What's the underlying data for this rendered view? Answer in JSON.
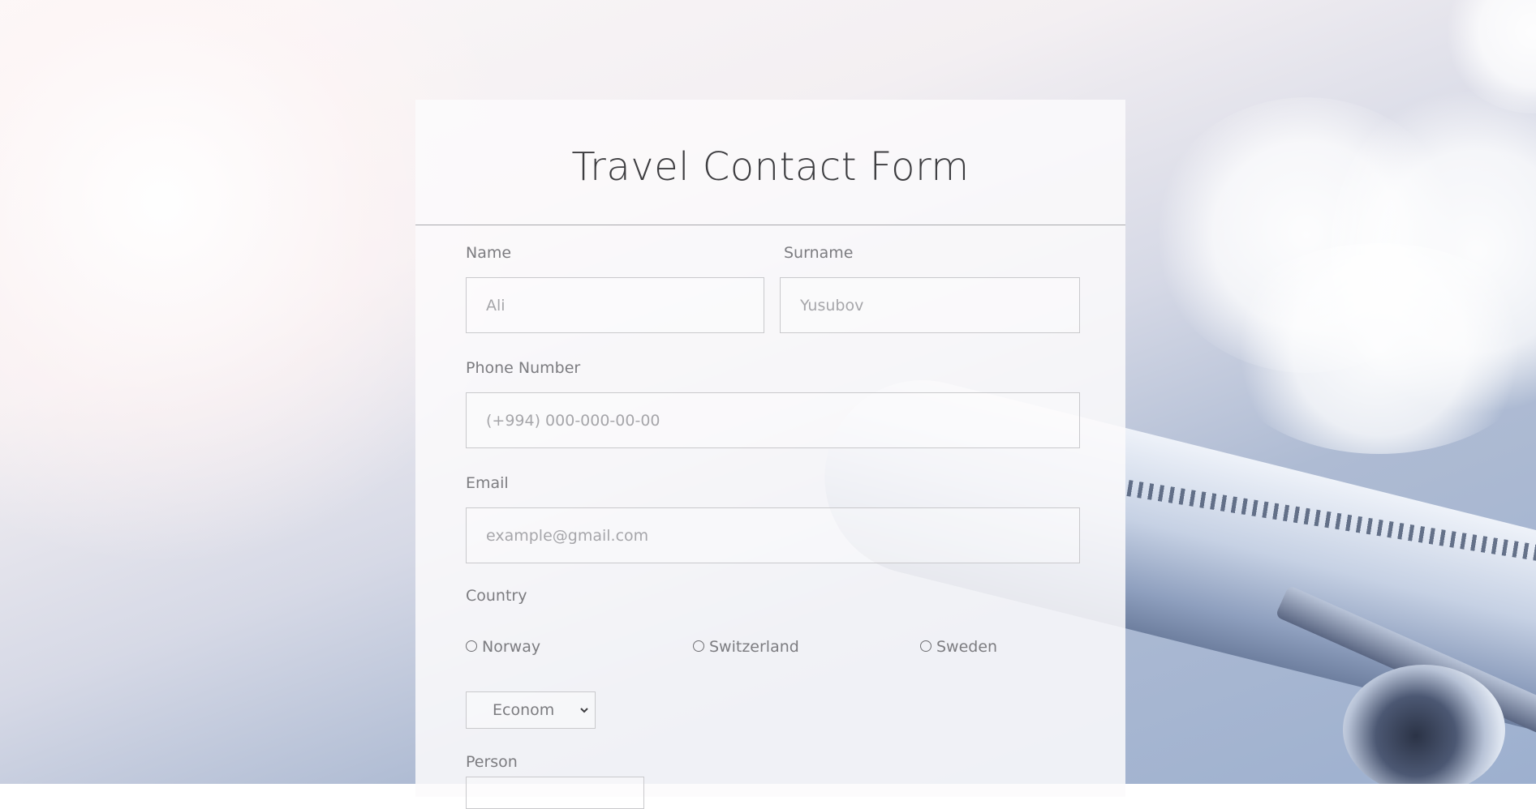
{
  "form": {
    "title": "Travel Contact Form",
    "name": {
      "label": "Name",
      "placeholder": "Ali"
    },
    "surname": {
      "label": "Surname",
      "placeholder": "Yusubov"
    },
    "phone": {
      "label": "Phone Number",
      "placeholder": "(+994) 000-000-00-00"
    },
    "email": {
      "label": "Email",
      "placeholder": "example@gmail.com"
    },
    "country": {
      "label": "Country",
      "options": [
        "Norway",
        "Switzerland",
        "Sweden"
      ]
    },
    "class_select": {
      "value": "Econom",
      "icon": "chevron-down-icon"
    },
    "person": {
      "label": "Person"
    }
  },
  "colors": {
    "title": "#3d3d40",
    "label": "#7c7c80",
    "placeholder": "#a6a6aa",
    "border": "#c9c9cc"
  }
}
